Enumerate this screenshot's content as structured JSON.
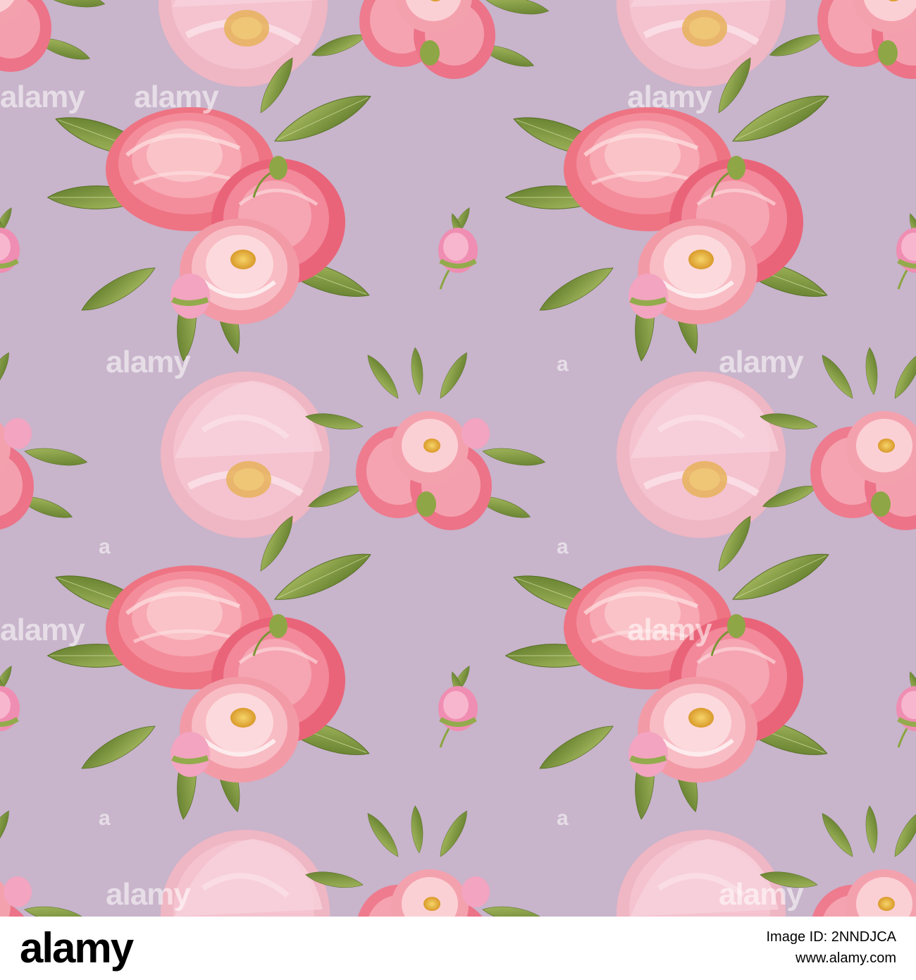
{
  "image": {
    "subject": "seamless-peony-pattern",
    "background_color": "#c8b4cb",
    "palette": {
      "petal_deep": "#ee6f80",
      "petal_mid": "#f59aa6",
      "petal_light": "#f9c3c8",
      "petal_pale": "#f5c6d0",
      "center_yellow": "#e9b537",
      "leaf_dark": "#6e8430",
      "leaf_light": "#a4b85a"
    }
  },
  "watermark": {
    "text": "alamy",
    "glyph": "a"
  },
  "footer": {
    "logo_text": "alamy",
    "image_id_line": "Image ID: 2NNDJCA",
    "url": "www.alamy.com"
  }
}
